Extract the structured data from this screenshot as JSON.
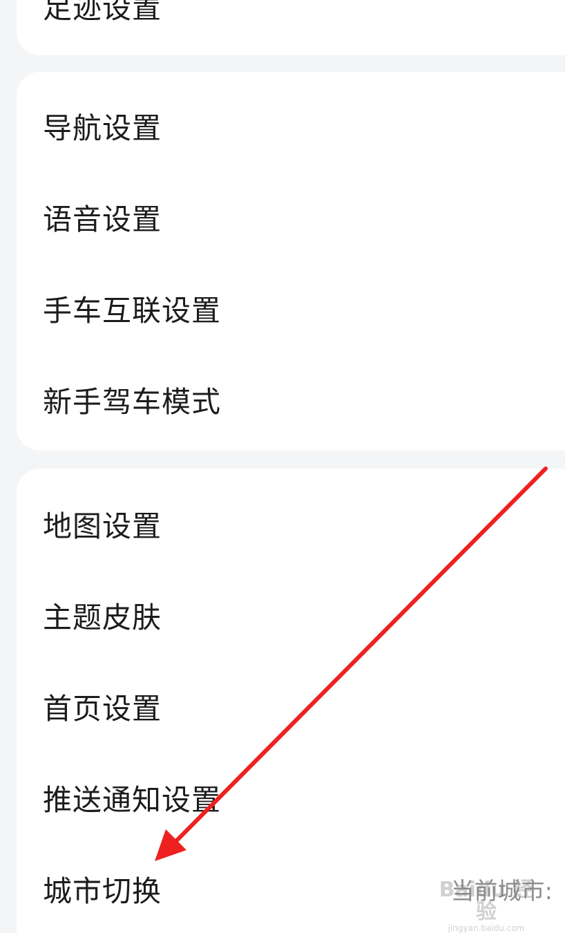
{
  "cards": {
    "top": {
      "items": [
        {
          "label": "足迹设置"
        }
      ]
    },
    "navigation": {
      "items": [
        {
          "label": "导航设置"
        },
        {
          "label": "语音设置"
        },
        {
          "label": "手车互联设置"
        },
        {
          "label": "新手驾车模式"
        }
      ]
    },
    "map": {
      "items": [
        {
          "label": "地图设置"
        },
        {
          "label": "主题皮肤"
        },
        {
          "label": "首页设置"
        },
        {
          "label": "推送通知设置"
        },
        {
          "label": "城市切换",
          "value": "当前城市:"
        }
      ]
    }
  },
  "annotation": {
    "arrow_color": "#ee2020"
  },
  "watermark": {
    "brand": "Baidu 经验",
    "url": "jingyan.baidu.com"
  }
}
